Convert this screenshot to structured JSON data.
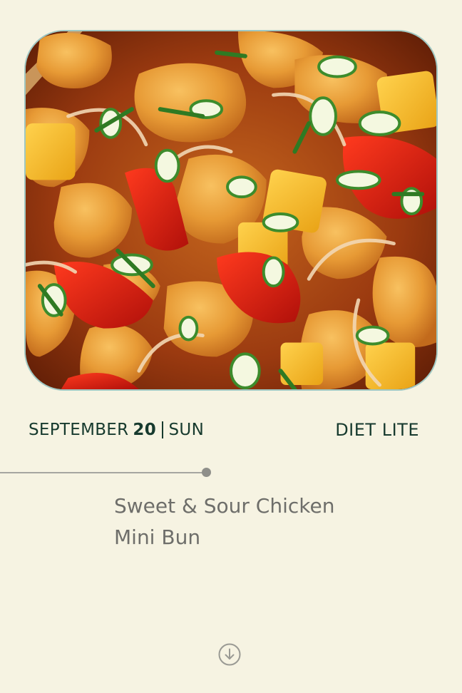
{
  "hero": {
    "image_alt": "Sweet and sour chicken with peppers, pineapple, onions and scallions"
  },
  "date": {
    "month": "SEPTEMBER",
    "day": "20",
    "weekday": "SUN"
  },
  "plan": {
    "label": "DIET LITE"
  },
  "meal": {
    "line1": "Sweet & Sour Chicken",
    "line2": "Mini Bun"
  },
  "icons": {
    "scroll": "arrow-down-circle-icon"
  },
  "colors": {
    "background": "#f6f3e2",
    "dark_text": "#173a2e",
    "meal_text": "#6e6e6a",
    "hero_border": "#9fc7c2"
  }
}
